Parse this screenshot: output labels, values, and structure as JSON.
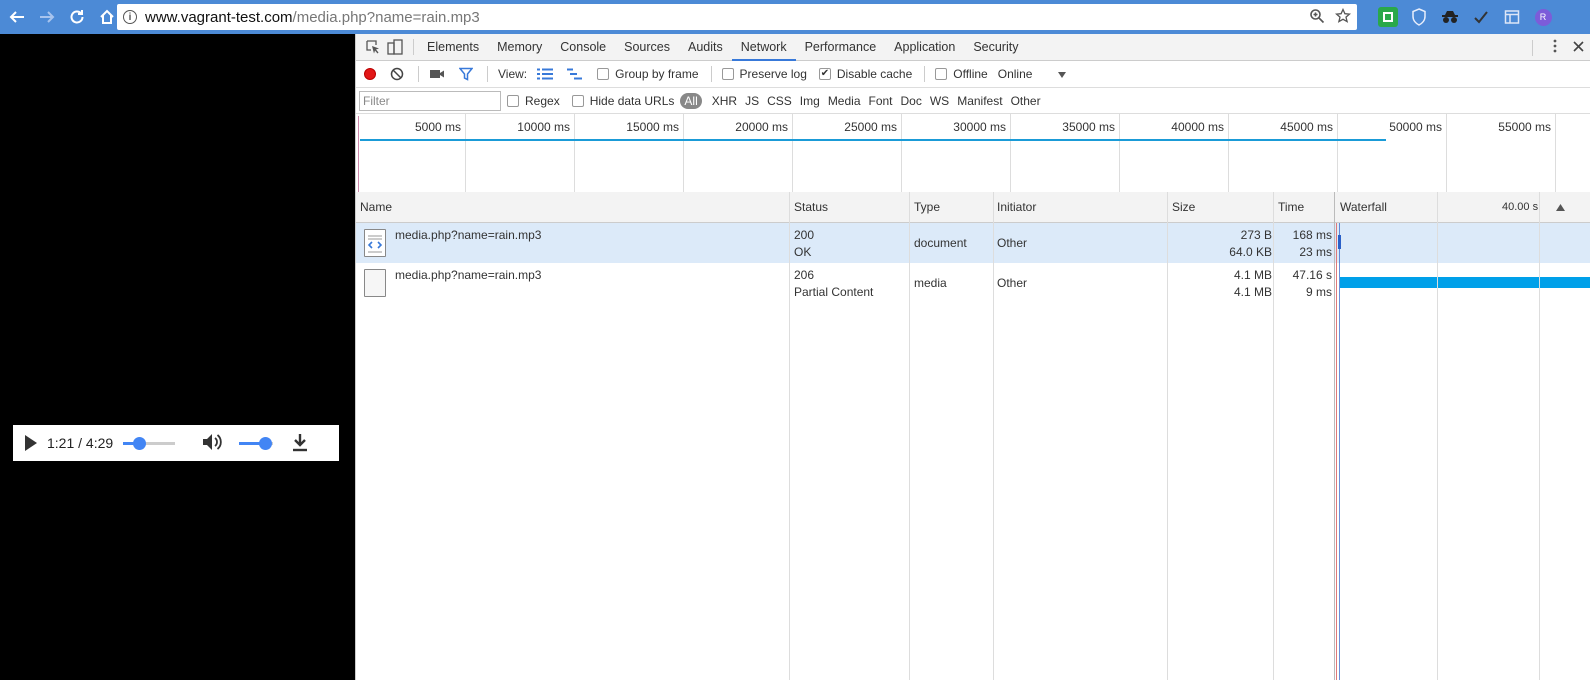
{
  "browser": {
    "url_host": "www.vagrant-test.com",
    "url_path": "/media.php?name=rain.mp3"
  },
  "player": {
    "time": "1:21 / 4:29",
    "progress_fraction": 0.3,
    "volume_fraction": 0.75
  },
  "devtools": {
    "tabs": [
      "Elements",
      "Memory",
      "Console",
      "Sources",
      "Audits",
      "Network",
      "Performance",
      "Application",
      "Security"
    ],
    "active_tab": "Network",
    "toolbar": {
      "view_label": "View:",
      "group_by_frame": "Group by frame",
      "preserve_log": "Preserve log",
      "disable_cache": "Disable cache",
      "disable_cache_checked": true,
      "offline": "Offline",
      "throttle": "Online"
    },
    "filterbar": {
      "placeholder": "Filter",
      "regex": "Regex",
      "hide_data_urls": "Hide data URLs",
      "types": [
        "All",
        "XHR",
        "JS",
        "CSS",
        "Img",
        "Media",
        "Font",
        "Doc",
        "WS",
        "Manifest",
        "Other"
      ]
    },
    "overview_ticks": [
      "5000 ms",
      "10000 ms",
      "15000 ms",
      "20000 ms",
      "25000 ms",
      "30000 ms",
      "35000 ms",
      "40000 ms",
      "45000 ms",
      "50000 ms",
      "55000 ms"
    ],
    "columns": {
      "name": "Name",
      "status": "Status",
      "type": "Type",
      "initiator": "Initiator",
      "size": "Size",
      "time": "Time",
      "waterfall": "Waterfall",
      "waterfall_scale": "40.00 s"
    },
    "rows": [
      {
        "name": "media.php?name=rain.mp3",
        "status_code": "200",
        "status_text": "OK",
        "type": "document",
        "initiator": "Other",
        "size": "273 B",
        "content_size": "64.0 KB",
        "time": "168 ms",
        "latency": "23 ms"
      },
      {
        "name": "media.php?name=rain.mp3",
        "status_code": "206",
        "status_text": "Partial Content",
        "type": "media",
        "initiator": "Other",
        "size": "4.1 MB",
        "content_size": "4.1 MB",
        "time": "47.16 s",
        "latency": "9 ms"
      }
    ]
  },
  "colors": {
    "browser_bar": "#4c8ad6",
    "accent": "#3879d9",
    "record": "#e21717",
    "waterfall_bar": "#00a0e9"
  }
}
